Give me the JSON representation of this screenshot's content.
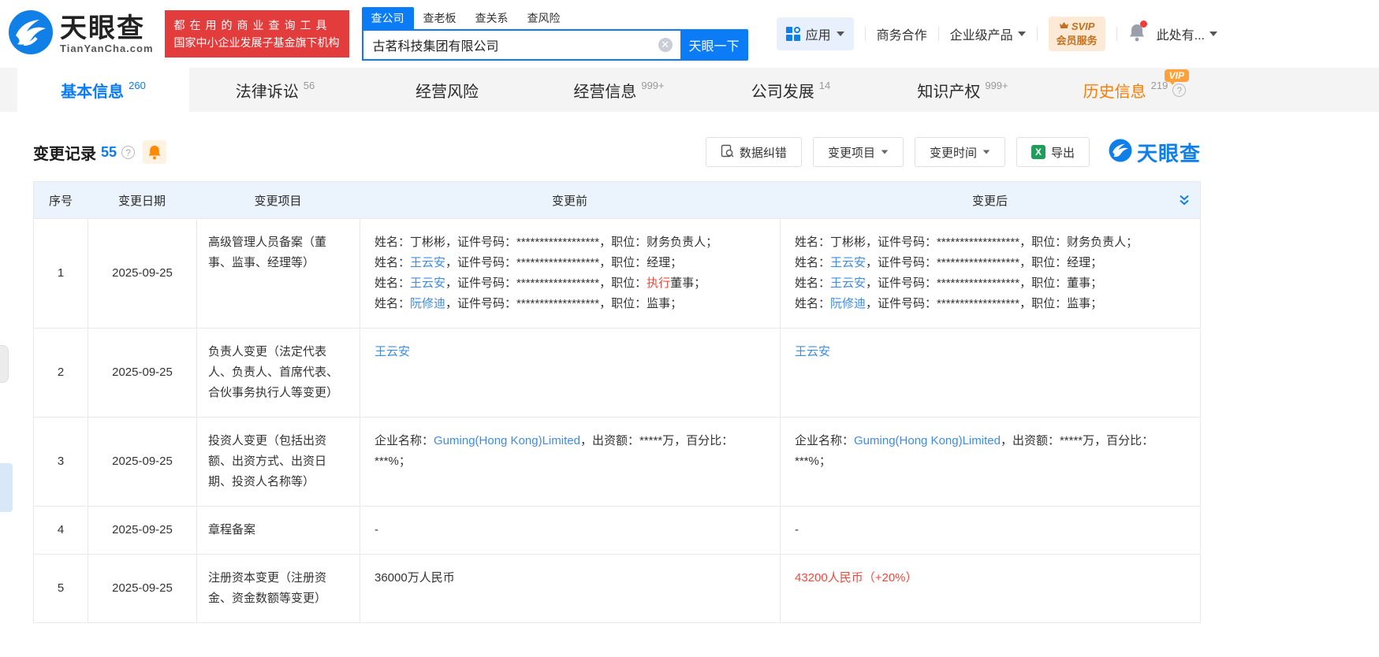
{
  "brand": {
    "name": "天眼查",
    "domain": "TianYanCha.com",
    "slogan_line1": "都在用的商业查询工具",
    "slogan_line2": "国家中小企业发展子基金旗下机构",
    "watermark": "天眼查"
  },
  "search": {
    "tabs": [
      {
        "label": "查公司"
      },
      {
        "label": "查老板"
      },
      {
        "label": "查关系"
      },
      {
        "label": "查风险"
      }
    ],
    "value": "古茗科技集团有限公司",
    "button": "天眼一下"
  },
  "topnav": {
    "apps": "应用",
    "cooperation": "商务合作",
    "enterprise": "企业级产品",
    "svip_top": "SVIP",
    "svip_bottom": "会员服务",
    "account": "此处有..."
  },
  "main_tabs": [
    {
      "label": "基本信息",
      "count": "260"
    },
    {
      "label": "法律诉讼",
      "count": "56"
    },
    {
      "label": "经营风险",
      "count": ""
    },
    {
      "label": "经营信息",
      "count": "999+"
    },
    {
      "label": "公司发展",
      "count": "14"
    },
    {
      "label": "知识产权",
      "count": "999+"
    },
    {
      "label": "历史信息",
      "count": "219",
      "vip": "VIP"
    }
  ],
  "section": {
    "title": "变更记录",
    "count": "55",
    "btn_correct": "数据纠错",
    "btn_project": "变更项目",
    "btn_time": "变更时间",
    "btn_export": "导出"
  },
  "table": {
    "headers": {
      "seq": "序号",
      "date": "变更日期",
      "project": "变更项目",
      "before": "变更前",
      "after": "变更后"
    },
    "rows": [
      {
        "seq": "1",
        "date": "2025-09-25",
        "project": "高级管理人员备案（董事、监事、经理等）",
        "before": [
          [
            {
              "t": "姓名：丁彬彬，证件号码：******************，职位：财务负责人；"
            }
          ],
          [
            {
              "t": "姓名："
            },
            {
              "t": "王云安",
              "c": "link"
            },
            {
              "t": "，证件号码：******************，职位：经理；"
            }
          ],
          [
            {
              "t": "姓名："
            },
            {
              "t": "王云安",
              "c": "link"
            },
            {
              "t": "，证件号码：******************，职位："
            },
            {
              "t": "执行",
              "c": "red"
            },
            {
              "t": "董事；"
            }
          ],
          [
            {
              "t": "姓名："
            },
            {
              "t": "阮修迪",
              "c": "link"
            },
            {
              "t": "，证件号码：******************，职位：监事；"
            }
          ]
        ],
        "after": [
          [
            {
              "t": "姓名：丁彬彬，证件号码：******************，职位：财务负责人；"
            }
          ],
          [
            {
              "t": "姓名："
            },
            {
              "t": "王云安",
              "c": "link"
            },
            {
              "t": "，证件号码：******************，职位：经理；"
            }
          ],
          [
            {
              "t": "姓名："
            },
            {
              "t": "王云安",
              "c": "link"
            },
            {
              "t": "，证件号码：******************，职位：董事；"
            }
          ],
          [
            {
              "t": "姓名："
            },
            {
              "t": "阮修迪",
              "c": "link"
            },
            {
              "t": "，证件号码：******************，职位：监事；"
            }
          ]
        ]
      },
      {
        "seq": "2",
        "date": "2025-09-25",
        "project": "负责人变更（法定代表人、负责人、首席代表、合伙事务执行人等变更）",
        "before": [
          [
            {
              "t": "王云安",
              "c": "link"
            }
          ]
        ],
        "after": [
          [
            {
              "t": "王云安",
              "c": "link"
            }
          ]
        ]
      },
      {
        "seq": "3",
        "date": "2025-09-25",
        "project": "投资人变更（包括出资额、出资方式、出资日期、投资人名称等）",
        "before": [
          [
            {
              "t": "企业名称："
            },
            {
              "t": "Guming(Hong Kong)Limited",
              "c": "link"
            },
            {
              "t": "，出资额：*****万，百分比：***%；"
            }
          ]
        ],
        "after": [
          [
            {
              "t": "企业名称："
            },
            {
              "t": "Guming(Hong Kong)Limited",
              "c": "link"
            },
            {
              "t": "，出资额：*****万，百分比：***%；"
            }
          ]
        ]
      },
      {
        "seq": "4",
        "date": "2025-09-25",
        "project": "章程备案",
        "before": [
          [
            {
              "t": "-"
            }
          ]
        ],
        "after": [
          [
            {
              "t": "-"
            }
          ]
        ]
      },
      {
        "seq": "5",
        "date": "2025-09-25",
        "project": "注册资本变更（注册资金、资金数额等变更）",
        "before": [
          [
            {
              "t": "36000万人民币"
            }
          ]
        ],
        "after": [
          [
            {
              "t": "43200人民币（+20%）",
              "c": "red"
            }
          ]
        ]
      }
    ]
  },
  "colors": {
    "accent": "#0b7cf6",
    "link": "#3d8ce6",
    "red": "#f4483c",
    "orange": "#ff7a00",
    "brand_red": "#e23c3c"
  }
}
